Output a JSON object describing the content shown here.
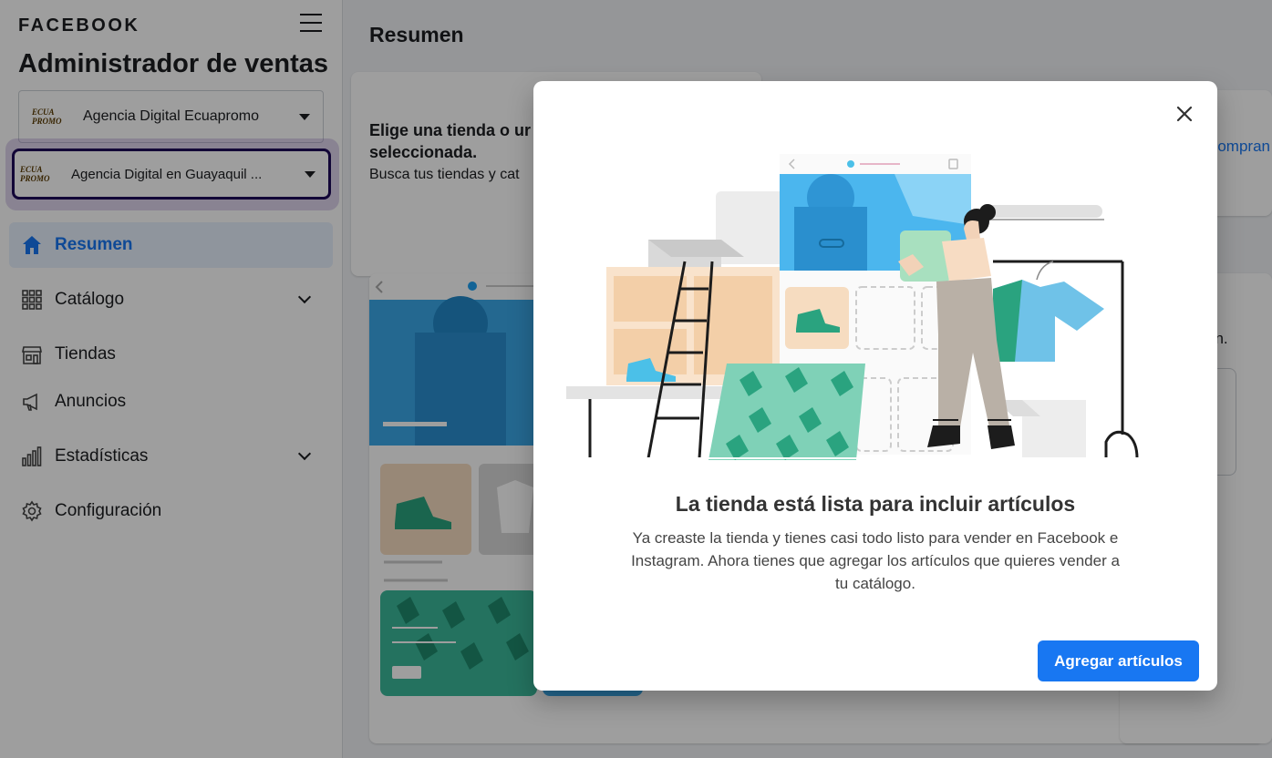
{
  "sidebar": {
    "brand": "FACEBOOK",
    "title": "Administrador de ventas",
    "account_select": {
      "logo_text": "ECUA PROMO",
      "label": "Agencia Digital Ecuapromo"
    },
    "store_select": {
      "logo_text": "ECUA PROMO",
      "label": "Agencia Digital en Guayaquil ..."
    },
    "items": [
      {
        "label": "Resumen",
        "icon": "home-icon",
        "active": true
      },
      {
        "label": "Catálogo",
        "icon": "grid-icon"
      },
      {
        "label": "Tiendas",
        "icon": "store-icon"
      },
      {
        "label": "Anuncios",
        "icon": "megaphone-icon"
      },
      {
        "label": "Estadísticas",
        "icon": "bar-chart-icon"
      },
      {
        "label": "Configuración",
        "icon": "gear-icon"
      }
    ]
  },
  "main": {
    "title": "Resumen",
    "card1": {
      "heading": "Elige una tienda o ur cuenta del administr seleccionada.",
      "sub": "Busca tus tiendas y cat"
    },
    "card2": {
      "link": "Compran"
    },
    "card4": {
      "text": "án."
    }
  },
  "modal": {
    "title": "La tienda está lista para incluir artículos",
    "body": "Ya creaste la tienda y tienes casi todo listo para vender en Facebook e Instagram. Ahora tienes que agregar los artículos que quieres vender a tu catálogo.",
    "primary_button": "Agregar artículos"
  },
  "colors": {
    "accent": "#1877f2",
    "active_bg": "#e7f0fd",
    "overlay": "rgba(0,0,0,0.38)"
  }
}
